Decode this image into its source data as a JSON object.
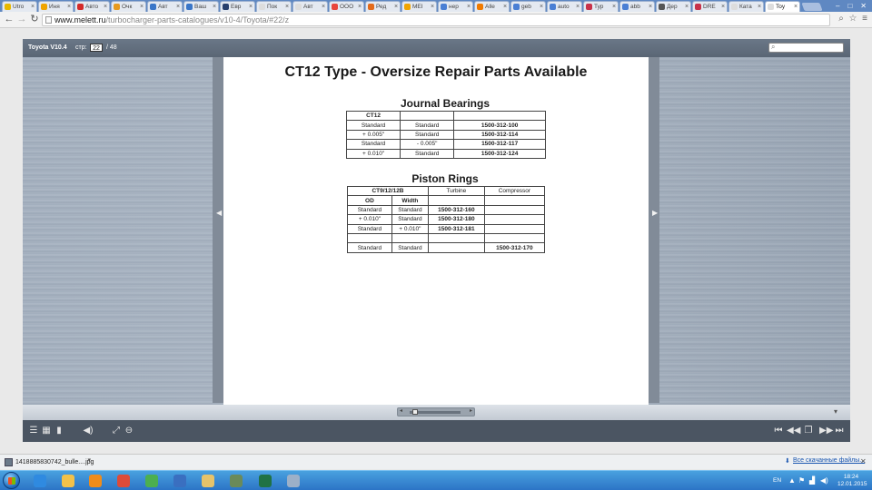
{
  "browser": {
    "tabs": [
      {
        "title": "Utro",
        "color": "#e7b800"
      },
      {
        "title": "Иня",
        "color": "#f0a400"
      },
      {
        "title": "Авто",
        "color": "#d42a2a"
      },
      {
        "title": "Очк",
        "color": "#e79a1e"
      },
      {
        "title": "Авт",
        "color": "#3a76c8"
      },
      {
        "title": "Ваш",
        "color": "#3a76c8"
      },
      {
        "title": "Евр",
        "color": "#27406e"
      },
      {
        "title": "Пок",
        "color": "#dddddd"
      },
      {
        "title": "Авт",
        "color": "#dddddd"
      },
      {
        "title": "ООО",
        "color": "#e8453c"
      },
      {
        "title": "Ред",
        "color": "#e36a1a"
      },
      {
        "title": "MEI",
        "color": "#f0a400"
      },
      {
        "title": "нер",
        "color": "#4a7fd4"
      },
      {
        "title": "Alle",
        "color": "#f07a00"
      },
      {
        "title": "geb",
        "color": "#4a7fd4"
      },
      {
        "title": "auto",
        "color": "#4a7fd4"
      },
      {
        "title": "Тур",
        "color": "#c8324a"
      },
      {
        "title": "abb",
        "color": "#4a7fd4"
      },
      {
        "title": "Дер",
        "color": "#555555"
      },
      {
        "title": "DRE",
        "color": "#c8324a"
      },
      {
        "title": "Ката",
        "color": "#dddddd"
      },
      {
        "title": "Toy",
        "color": "#dddddd"
      }
    ],
    "url_host": "www.melett.ru",
    "url_path": "/turbocharger-parts-catalogues/v10-4/Toyota/#22/z"
  },
  "viewer": {
    "title": "Toyota V10.4",
    "page_label": "стр:",
    "current_page": "22",
    "total_pages": "/ 48"
  },
  "document": {
    "title": "CT12 Type - Oversize Repair Parts Available",
    "journal_bearings": {
      "title": "Journal Bearings",
      "rows": [
        [
          {
            "t": "CT12",
            "b": true
          },
          {
            "t": ""
          },
          {
            "t": ""
          }
        ],
        [
          {
            "t": "Standard"
          },
          {
            "t": "Standard"
          },
          {
            "t": "1500-312-100",
            "b": true
          }
        ],
        [
          {
            "t": "+ 0.005\""
          },
          {
            "t": "Standard"
          },
          {
            "t": "1500-312-114",
            "b": true
          }
        ],
        [
          {
            "t": "Standard"
          },
          {
            "t": "- 0.005\""
          },
          {
            "t": "1500-312-117",
            "b": true
          }
        ],
        [
          {
            "t": "+ 0.010\""
          },
          {
            "t": "Standard"
          },
          {
            "t": "1500-312-124",
            "b": true
          }
        ]
      ]
    },
    "piston_rings": {
      "title": "Piston Rings",
      "header_group": "CT9/12/12B",
      "header_turbine": "Turbine",
      "header_compressor": "Compressor",
      "rows": [
        [
          {
            "t": "OD",
            "b": true
          },
          {
            "t": "Width",
            "b": true
          },
          {
            "t": ""
          },
          {
            "t": ""
          }
        ],
        [
          {
            "t": "Standard"
          },
          {
            "t": "Standard"
          },
          {
            "t": "1500-312-160",
            "b": true
          },
          {
            "t": ""
          }
        ],
        [
          {
            "t": "+ 0.010\""
          },
          {
            "t": "Standard"
          },
          {
            "t": "1500-312-180",
            "b": true
          },
          {
            "t": ""
          }
        ],
        [
          {
            "t": "Standard"
          },
          {
            "t": "+ 0.010\""
          },
          {
            "t": "1500-312-181",
            "b": true
          },
          {
            "t": ""
          }
        ],
        [
          {
            "t": ""
          },
          {
            "t": ""
          },
          {
            "t": ""
          },
          {
            "t": ""
          }
        ],
        [
          {
            "t": "Standard"
          },
          {
            "t": "Standard"
          },
          {
            "t": ""
          },
          {
            "t": "1500-312-170",
            "b": true
          }
        ]
      ]
    }
  },
  "downloads": {
    "filename": "1418885830742_bulle....jpg",
    "show_all": "Все скачанные файлы..."
  },
  "taskbar": {
    "apps": [
      {
        "name": "internet-explorer",
        "color": "#2f8ae0"
      },
      {
        "name": "file-explorer",
        "color": "#f2c14a"
      },
      {
        "name": "media-player",
        "color": "#f08c1a"
      },
      {
        "name": "chrome",
        "color": "#dd4b39"
      },
      {
        "name": "icq",
        "color": "#4caf50"
      },
      {
        "name": "network-app",
        "color": "#3a6fc0"
      },
      {
        "name": "folder",
        "color": "#e6c36a"
      },
      {
        "name": "globe-app",
        "color": "#6a8a5a"
      },
      {
        "name": "excel",
        "color": "#207245"
      },
      {
        "name": "notepad",
        "color": "#9cb0c8"
      }
    ],
    "language": "EN",
    "time": "18:24",
    "date": "12.01.2015"
  }
}
